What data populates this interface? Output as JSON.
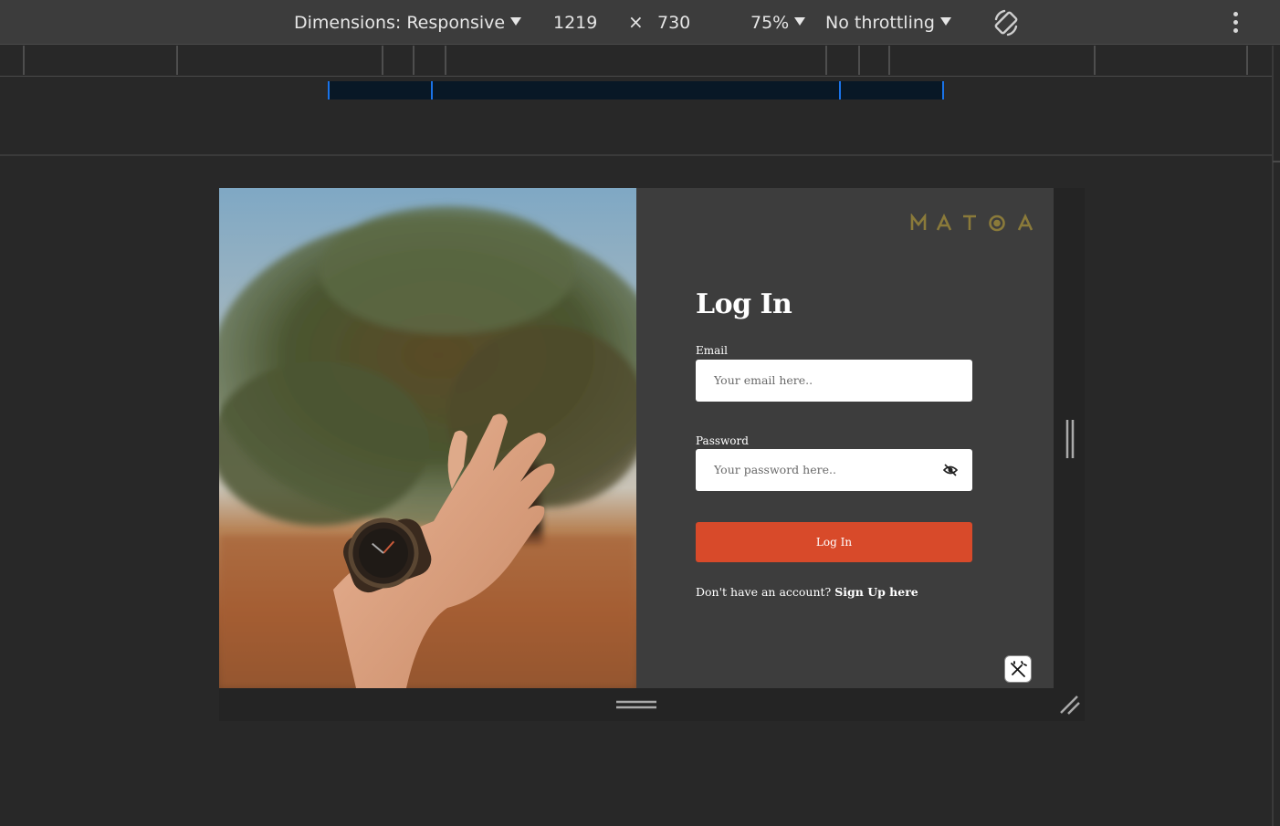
{
  "devtools": {
    "dimensions_label": "Dimensions: Responsive",
    "width": "1219",
    "times": "×",
    "height": "730",
    "zoom": "75%",
    "throttling": "No throttling"
  },
  "page": {
    "brand": "MATOA",
    "title": "Log In",
    "email_label": "Email",
    "email_placeholder": "Your email here..",
    "password_label": "Password",
    "password_placeholder": "Your password here..",
    "login_button": "Log In",
    "signup_prompt": "Don't have an account?",
    "signup_link": "Sign Up here"
  },
  "colors": {
    "accent": "#d84a2a",
    "brand_gold": "#8a7a3a",
    "panel_bg": "#3d3d3d"
  }
}
